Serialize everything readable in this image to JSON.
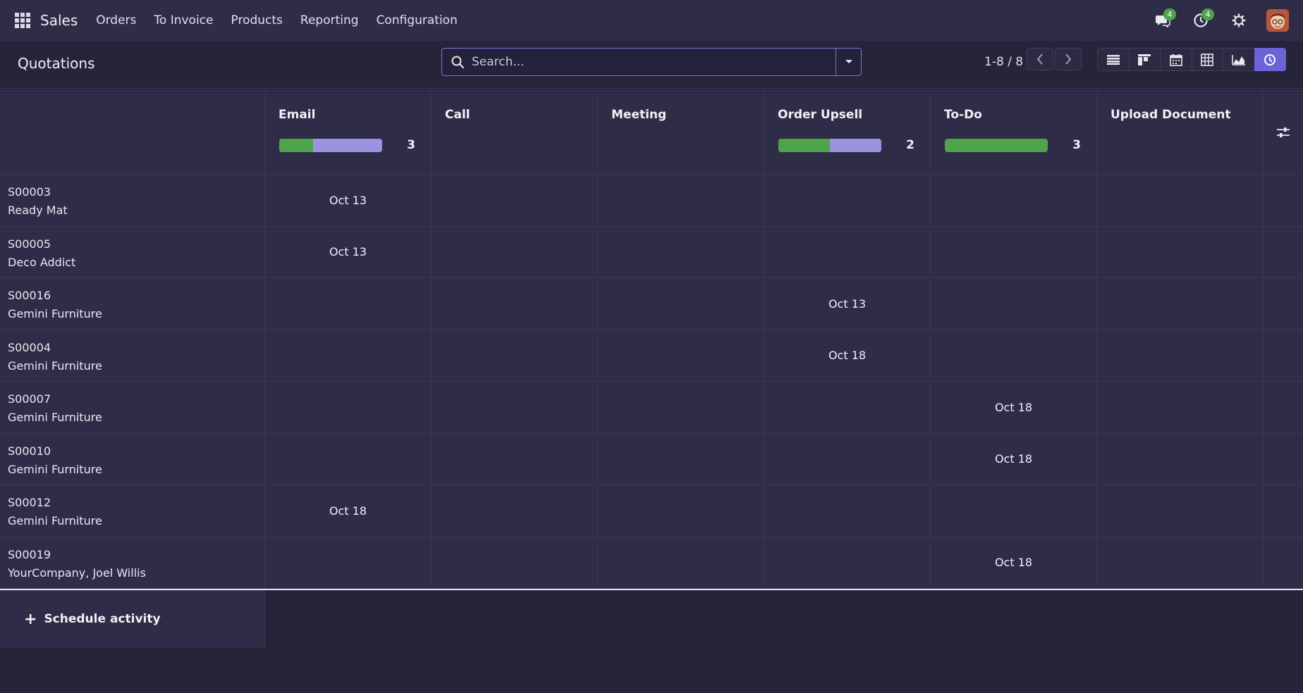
{
  "navbar": {
    "app_name": "Sales",
    "menu": [
      "Orders",
      "To Invoice",
      "Products",
      "Reporting",
      "Configuration"
    ],
    "messages_count": "4",
    "activities_count": "4",
    "icons": [
      "apps-grid-icon",
      "chat-icon",
      "clock-icon",
      "gear-icon",
      "avatar"
    ]
  },
  "control_panel": {
    "title": "Quotations",
    "search_placeholder": "Search...",
    "pager": "1-8 / 8",
    "views": [
      "list-view-icon",
      "kanban-view-icon",
      "calendar-view-icon",
      "pivot-view-icon",
      "graph-view-icon",
      "activity-view-icon"
    ],
    "active_view": "activity"
  },
  "activity_types": [
    {
      "label": "Email",
      "count": "3",
      "progress": {
        "done": 0.33,
        "planned": 0.67
      }
    },
    {
      "label": "Call",
      "count": "",
      "progress": null
    },
    {
      "label": "Meeting",
      "count": "",
      "progress": null
    },
    {
      "label": "Order Upsell",
      "count": "2",
      "progress": {
        "done": 0.5,
        "planned": 0.5
      }
    },
    {
      "label": "To-Do",
      "count": "3",
      "progress": {
        "done": 1.0,
        "planned": 0.0
      }
    },
    {
      "label": "Upload Document",
      "count": "",
      "progress": null
    }
  ],
  "records": [
    {
      "ref": "S00003",
      "partner": "Ready Mat",
      "cells": [
        "Oct 13",
        "",
        "",
        "",
        "",
        ""
      ]
    },
    {
      "ref": "S00005",
      "partner": "Deco Addict",
      "cells": [
        "Oct 13",
        "",
        "",
        "",
        "",
        ""
      ]
    },
    {
      "ref": "S00016",
      "partner": "Gemini Furniture",
      "cells": [
        "",
        "",
        "",
        "Oct 13",
        "",
        ""
      ]
    },
    {
      "ref": "S00004",
      "partner": "Gemini Furniture",
      "cells": [
        "",
        "",
        "",
        "Oct 18",
        "",
        ""
      ]
    },
    {
      "ref": "S00007",
      "partner": "Gemini Furniture",
      "cells": [
        "",
        "",
        "",
        "",
        "Oct 18",
        ""
      ]
    },
    {
      "ref": "S00010",
      "partner": "Gemini Furniture",
      "cells": [
        "",
        "",
        "",
        "",
        "Oct 18",
        ""
      ]
    },
    {
      "ref": "S00012",
      "partner": "Gemini Furniture",
      "cells": [
        "Oct 18",
        "",
        "",
        "",
        "",
        ""
      ]
    },
    {
      "ref": "S00019",
      "partner": "YourCompany, Joel Willis",
      "cells": [
        "",
        "",
        "",
        "",
        "Oct 18",
        ""
      ]
    }
  ],
  "footer": {
    "schedule_label": "Schedule activity"
  },
  "colors": {
    "done": "#4fa34a",
    "planned": "#9b92e0",
    "accent": "#6c63d9"
  }
}
